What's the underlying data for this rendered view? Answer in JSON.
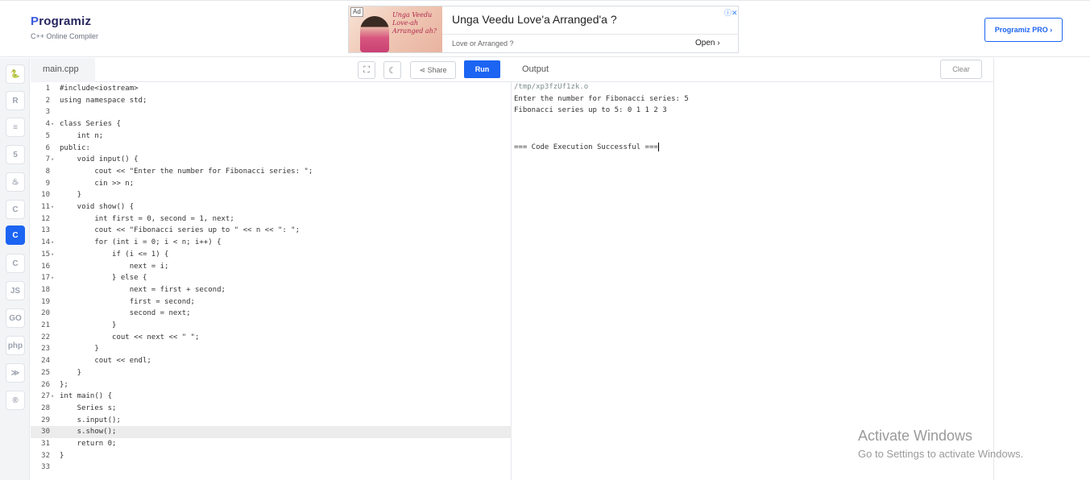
{
  "header": {
    "logo_name_p": "P",
    "logo_name_rest": "rogramiz",
    "logo_sub": "C++ Online Compiler",
    "pro_label": "Programiz PRO ›"
  },
  "ad": {
    "badge": "Ad",
    "script": "Unga Veedu Love-ah Arranged ah?",
    "title": "Unga Veedu Love'a Arranged'a ?",
    "subtitle": "Love or Arranged ?",
    "open_label": "Open ›",
    "close_glyph": "ⓘ✕"
  },
  "sidebar": {
    "items": [
      {
        "name": "python-icon",
        "glyph": "🐍"
      },
      {
        "name": "r-icon",
        "glyph": "R"
      },
      {
        "name": "sql-icon",
        "glyph": "≡"
      },
      {
        "name": "html-icon",
        "glyph": "5"
      },
      {
        "name": "java-icon",
        "glyph": "♨"
      },
      {
        "name": "c-icon",
        "glyph": "C"
      },
      {
        "name": "cpp-icon",
        "glyph": "C"
      },
      {
        "name": "csharp-icon",
        "glyph": "C"
      },
      {
        "name": "js-icon",
        "glyph": "JS"
      },
      {
        "name": "go-icon",
        "glyph": "GO"
      },
      {
        "name": "php-icon",
        "glyph": "php"
      },
      {
        "name": "swift-icon",
        "glyph": "≫"
      },
      {
        "name": "rust-icon",
        "glyph": "®"
      }
    ],
    "active_index": 6
  },
  "editor": {
    "tab_label": "main.cpp",
    "share_label": "Share",
    "run_label": "Run",
    "active_line": 30,
    "lines": [
      {
        "n": "1",
        "fold": "",
        "code": "#include<iostream>"
      },
      {
        "n": "2",
        "fold": "",
        "code": "using namespace std;"
      },
      {
        "n": "3",
        "fold": "",
        "code": ""
      },
      {
        "n": "4",
        "fold": "▾",
        "code": "class Series {"
      },
      {
        "n": "5",
        "fold": "",
        "code": "    int n;"
      },
      {
        "n": "6",
        "fold": "",
        "code": "public:"
      },
      {
        "n": "7",
        "fold": "▾",
        "code": "    void input() {"
      },
      {
        "n": "8",
        "fold": "",
        "code": "        cout << \"Enter the number for Fibonacci series: \";"
      },
      {
        "n": "9",
        "fold": "",
        "code": "        cin >> n;"
      },
      {
        "n": "10",
        "fold": "",
        "code": "    }"
      },
      {
        "n": "11",
        "fold": "▾",
        "code": "    void show() {"
      },
      {
        "n": "12",
        "fold": "",
        "code": "        int first = 0, second = 1, next;"
      },
      {
        "n": "13",
        "fold": "",
        "code": "        cout << \"Fibonacci series up to \" << n << \": \";"
      },
      {
        "n": "14",
        "fold": "▾",
        "code": "        for (int i = 0; i < n; i++) {"
      },
      {
        "n": "15",
        "fold": "▾",
        "code": "            if (i <= 1) {"
      },
      {
        "n": "16",
        "fold": "",
        "code": "                next = i;"
      },
      {
        "n": "17",
        "fold": "▾",
        "code": "            } else {"
      },
      {
        "n": "18",
        "fold": "",
        "code": "                next = first + second;"
      },
      {
        "n": "19",
        "fold": "",
        "code": "                first = second;"
      },
      {
        "n": "20",
        "fold": "",
        "code": "                second = next;"
      },
      {
        "n": "21",
        "fold": "",
        "code": "            }"
      },
      {
        "n": "22",
        "fold": "",
        "code": "            cout << next << \" \";"
      },
      {
        "n": "23",
        "fold": "",
        "code": "        }"
      },
      {
        "n": "24",
        "fold": "",
        "code": "        cout << endl;"
      },
      {
        "n": "25",
        "fold": "",
        "code": "    }"
      },
      {
        "n": "26",
        "fold": "",
        "code": "};"
      },
      {
        "n": "27",
        "fold": "▾",
        "code": "int main() {"
      },
      {
        "n": "28",
        "fold": "",
        "code": "    Series s;"
      },
      {
        "n": "29",
        "fold": "",
        "code": "    s.input();"
      },
      {
        "n": "30",
        "fold": "",
        "code": "    s.show();"
      },
      {
        "n": "31",
        "fold": "",
        "code": "    return 0;"
      },
      {
        "n": "32",
        "fold": "",
        "code": "}"
      },
      {
        "n": "33",
        "fold": "",
        "code": ""
      }
    ]
  },
  "output": {
    "title": "Output",
    "clear_label": "Clear",
    "lines": [
      {
        "text": "/tmp/xp3fzUf1zk.o",
        "cls": "out-path"
      },
      {
        "text": "Enter the number for Fibonacci series: 5",
        "cls": ""
      },
      {
        "text": "Fibonacci series up to 5: 0 1 1 2 3",
        "cls": ""
      },
      {
        "text": "",
        "cls": ""
      },
      {
        "text": "",
        "cls": ""
      },
      {
        "text": "=== Code Execution Successful ===",
        "cls": ""
      }
    ]
  },
  "watermark": {
    "line1": "Activate Windows",
    "line2": "Go to Settings to activate Windows."
  }
}
